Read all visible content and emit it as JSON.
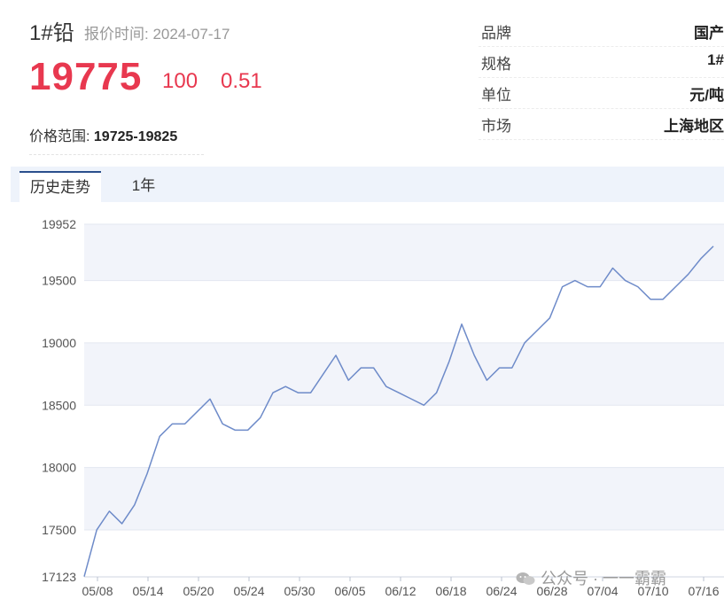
{
  "header": {
    "product": "1#铅",
    "quote_time": "报价时间: 2024-07-17",
    "price": "19775",
    "change": "100",
    "change_pct": "0.51",
    "range_label": "价格范围:",
    "range_value": "19725-19825"
  },
  "info": [
    {
      "label": "品牌",
      "value": "国产"
    },
    {
      "label": "规格",
      "value": "1#"
    },
    {
      "label": "单位",
      "value": "元/吨"
    },
    {
      "label": "市场",
      "value": "上海地区"
    }
  ],
  "tabs": [
    {
      "label": "历史走势",
      "active": true
    },
    {
      "label": "1年",
      "active": false
    }
  ],
  "watermark": "公众号 · 一一霸霸",
  "colors": {
    "accent_red": "#e8384f",
    "line": "#6e8bc9",
    "band": "#f2f4fa",
    "tab_bar": "#eef3fb"
  },
  "chart_data": {
    "type": "line",
    "title": "",
    "xlabel": "",
    "ylabel": "",
    "ylim": [
      17123,
      19952
    ],
    "y_ticks": [
      17123,
      17500,
      18000,
      18500,
      19000,
      19500,
      19952
    ],
    "x_ticks": [
      "05/08",
      "05/14",
      "05/20",
      "05/24",
      "05/30",
      "06/05",
      "06/12",
      "06/18",
      "06/24",
      "06/28",
      "07/04",
      "07/10",
      "07/16"
    ],
    "series": [
      {
        "values": [
          17125,
          17500,
          17650,
          17550,
          17700,
          17950,
          18250,
          18350,
          18350,
          18450,
          18550,
          18350,
          18300,
          18300,
          18400,
          18600,
          18650,
          18600,
          18600,
          18750,
          18900,
          18700,
          18800,
          18800,
          18650,
          18600,
          18550,
          18500,
          18600,
          18850,
          19150,
          18900,
          18700,
          18800,
          18800,
          19000,
          19100,
          19200,
          19450,
          19500,
          19450,
          19450,
          19600,
          19500,
          19450,
          19350,
          19350,
          19450,
          19550,
          19675,
          19775
        ]
      }
    ]
  }
}
